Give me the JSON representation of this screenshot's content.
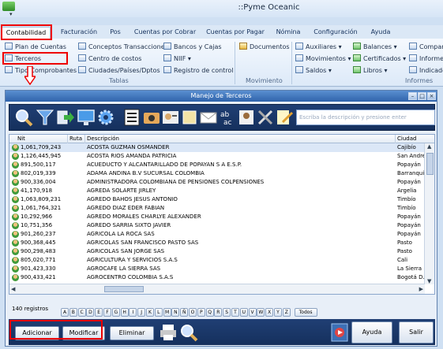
{
  "window": {
    "title": "::Pyme Oceanic"
  },
  "ribbon": {
    "tabs": [
      "Contabilidad",
      "Facturación",
      "Pos",
      "Cuentas por Cobrar",
      "Cuentas por Pagar",
      "Nómina",
      "Configuración",
      "Ayuda"
    ],
    "active_tab": "Contabilidad",
    "tablas": {
      "label": "Tablas",
      "col1": [
        "Plan de Cuentas",
        "Terceros",
        "Tipo Comprobantes"
      ],
      "col2": [
        "Conceptos Transacciones",
        "Centro de costos",
        "Ciudades/Países/Dptos"
      ],
      "col3": [
        "Bancos y Cajas",
        "NIIF",
        "Registro de control"
      ]
    },
    "movimiento": {
      "label": "Movimiento",
      "items": [
        "Documentos"
      ]
    },
    "informes": {
      "label": "Informes",
      "col1": [
        "Auxiliares",
        "Movimientos",
        "Saldos"
      ],
      "col2": [
        "Balances",
        "Certificados",
        "Libros"
      ],
      "col3": [
        "Compara",
        "Informe",
        "Indicado"
      ]
    }
  },
  "terceros_window": {
    "title": "Manejo de Terceros",
    "search_placeholder": "Escriba la descripción y presione enter",
    "columns": {
      "nit": "Nit",
      "ruta": "Ruta",
      "descripcion": "Descripción",
      "ciudad": "Ciudad"
    },
    "rows": [
      {
        "nit": "1,061,709,243",
        "ruta": "",
        "descripcion": "ACOSTA GUZMAN OSMANDER",
        "ciudad": "Cajibío"
      },
      {
        "nit": "1,126,445,945",
        "ruta": "",
        "descripcion": "ACOSTA RIOS AMANDA PATRICIA",
        "ciudad": "San Andrés d"
      },
      {
        "nit": "891,500,117",
        "ruta": "",
        "descripcion": "ACUEDUCTO Y ALCANTARILLADO DE POPAYAN S A E.S.P.",
        "ciudad": "Popayán"
      },
      {
        "nit": "802,019,339",
        "ruta": "",
        "descripcion": "ADAMA ANDINA B.V SUCURSAL COLOMBIA",
        "ciudad": "Barranquilla"
      },
      {
        "nit": "900,336,004",
        "ruta": "",
        "descripcion": "ADMINISTRADORA COLOMBIANA DE PENSIONES COLPENSIONES",
        "ciudad": "Popayán"
      },
      {
        "nit": "41,170,918",
        "ruta": "",
        "descripcion": "AGREDA SOLARTE JIRLEY",
        "ciudad": "Argelia"
      },
      {
        "nit": "1,063,809,231",
        "ruta": "",
        "descripcion": "AGREDO BAHOS JESUS ANTONIO",
        "ciudad": "Timbío"
      },
      {
        "nit": "1,061,764,321",
        "ruta": "",
        "descripcion": "AGREDO DIAZ EDER FABIAN",
        "ciudad": "Timbío"
      },
      {
        "nit": "10,292,966",
        "ruta": "",
        "descripcion": "AGREDO MORALES CHARLYE ALEXANDER",
        "ciudad": "Popayán"
      },
      {
        "nit": "10,751,356",
        "ruta": "",
        "descripcion": "AGREDO SARRIA SIXTO JAVIER",
        "ciudad": "Popayán"
      },
      {
        "nit": "901,260,237",
        "ruta": "",
        "descripcion": "AGRICOLA LA ROCA SAS",
        "ciudad": "Popayán"
      },
      {
        "nit": "900,368,445",
        "ruta": "",
        "descripcion": "AGRICOLAS SAN FRANCISCO PASTO SAS",
        "ciudad": "Pasto"
      },
      {
        "nit": "900,298,483",
        "ruta": "",
        "descripcion": "AGRICOLAS SAN JORGE SAS",
        "ciudad": "Pasto"
      },
      {
        "nit": "805,020,771",
        "ruta": "",
        "descripcion": "AGRICULTURA Y SERVICIOS S.A.S",
        "ciudad": "Cali"
      },
      {
        "nit": "901,423,330",
        "ruta": "",
        "descripcion": "AGROCAFE LA SIERRA SAS",
        "ciudad": "La Sierra"
      },
      {
        "nit": "900,433,421",
        "ruta": "",
        "descripcion": "AGROCENTRO COLOMBIA S.A.S",
        "ciudad": "Bogotá D.C."
      }
    ],
    "record_count": "140 registros",
    "letters": [
      "A",
      "B",
      "C",
      "D",
      "E",
      "F",
      "G",
      "H",
      "I",
      "J",
      "K",
      "L",
      "M",
      "N",
      "Ñ",
      "O",
      "P",
      "Q",
      "R",
      "S",
      "T",
      "U",
      "V",
      "W",
      "X",
      "Y",
      "Z"
    ],
    "todos_label": "Todos",
    "buttons": {
      "adicionar": "Adicionar",
      "modificar": "Modificar",
      "eliminar": "Eliminar",
      "ayuda": "Ayuda",
      "salir": "Salir"
    }
  },
  "colors": {
    "highlight": "#e00000",
    "toolbar": "#1b3766",
    "title_bar": "#3e73bd"
  }
}
